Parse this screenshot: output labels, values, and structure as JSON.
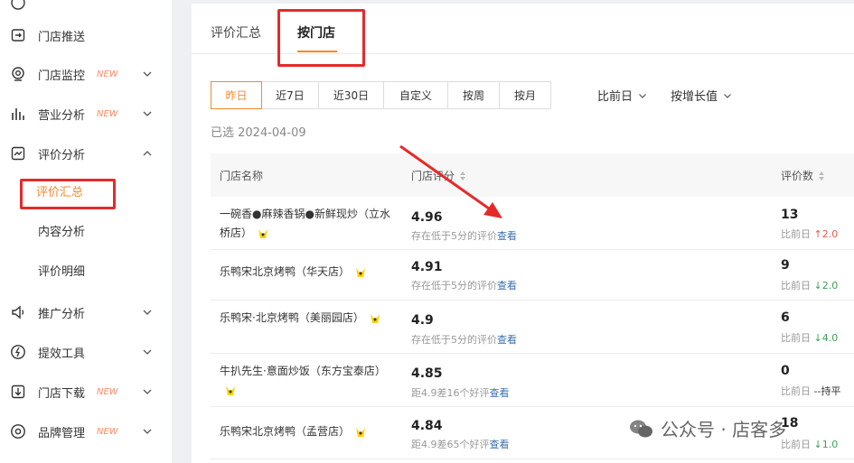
{
  "sidebar": {
    "items": [
      {
        "label": "门店推送",
        "icon": "push-icon"
      },
      {
        "label": "门店监控",
        "icon": "monitor-icon",
        "badge": "NEW"
      },
      {
        "label": "营业分析",
        "icon": "bar-chart-icon",
        "badge": "NEW"
      },
      {
        "label": "评价分析",
        "icon": "trend-icon"
      },
      {
        "label": "推广分析",
        "icon": "speaker-icon"
      },
      {
        "label": "提效工具",
        "icon": "lightning-icon"
      },
      {
        "label": "门店下载",
        "icon": "download-icon",
        "badge": "NEW"
      },
      {
        "label": "品牌管理",
        "icon": "brand-icon",
        "badge": "NEW"
      }
    ],
    "sub_items": [
      "评价汇总",
      "内容分析",
      "评价明细"
    ]
  },
  "tabs": [
    "评价汇总",
    "按门店"
  ],
  "date_ranges": [
    "昨日",
    "近7日",
    "近30日",
    "自定义",
    "按周",
    "按月"
  ],
  "compare": {
    "baseline": "比前日",
    "sort": "按增长值"
  },
  "selected_date": "已选 2024-04-09",
  "table": {
    "headers": {
      "store": "门店名称",
      "score": "门店评分",
      "count": "评价数"
    },
    "rows": [
      {
        "store": "一碗香●麻辣香锅●新鲜现炒（立水桥店）",
        "score": "4.96",
        "note": "存在低于5分的评价",
        "link": "查看",
        "count": "13",
        "delta_label": "比前日",
        "delta": "↑2.0"
      },
      {
        "store": "乐鸭宋北京烤鸭（华天店）",
        "score": "4.91",
        "note": "存在低于5分的评价",
        "link": "查看",
        "count": "9",
        "delta_label": "比前日",
        "delta": "↓2.0"
      },
      {
        "store": "乐鸭宋·北京烤鸭（美丽园店）",
        "score": "4.9",
        "note": "存在低于5分的评价",
        "link": "查看",
        "count": "6",
        "delta_label": "比前日",
        "delta": "↓4.0"
      },
      {
        "store": "牛扒先生·意面炒饭（东方宝泰店）",
        "score": "4.85",
        "note": "距4.9差16个好评",
        "link": "查看",
        "count": "0",
        "delta_label": "比前日",
        "delta": "--持平"
      },
      {
        "store": "乐鸭宋北京烤鸭（孟营店）",
        "score": "4.84",
        "note": "距4.9差65个好评",
        "link": "查看",
        "count": "18",
        "delta_label": "比前日",
        "delta": "↓1.0"
      }
    ]
  },
  "watermark": "公众号 · 店客多",
  "colors": {
    "accent": "#f38a2a",
    "highlight": "#e52a2a",
    "link": "#3a6fb0",
    "up": "#e35a4a",
    "down": "#3ca25a"
  }
}
